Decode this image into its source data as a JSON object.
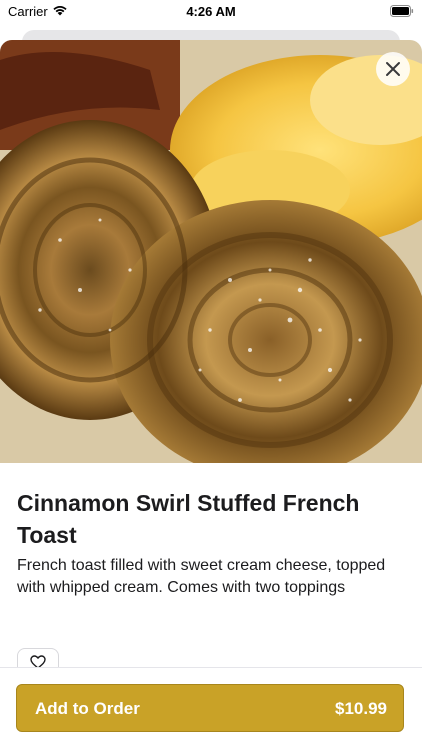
{
  "status_bar": {
    "carrier": "Carrier",
    "time": "4:26 AM"
  },
  "item": {
    "title": "Cinnamon Swirl Stuffed French Toast",
    "description": "French toast filled with sweet cream cheese, topped with whipped cream. Comes with two toppings",
    "image_icon": "food-photo"
  },
  "actions": {
    "close_icon": "close-icon",
    "favorite_icon": "heart-icon",
    "add_to_order_label": "Add to Order",
    "price": "$10.99"
  },
  "colors": {
    "accent": "#c9a227"
  }
}
